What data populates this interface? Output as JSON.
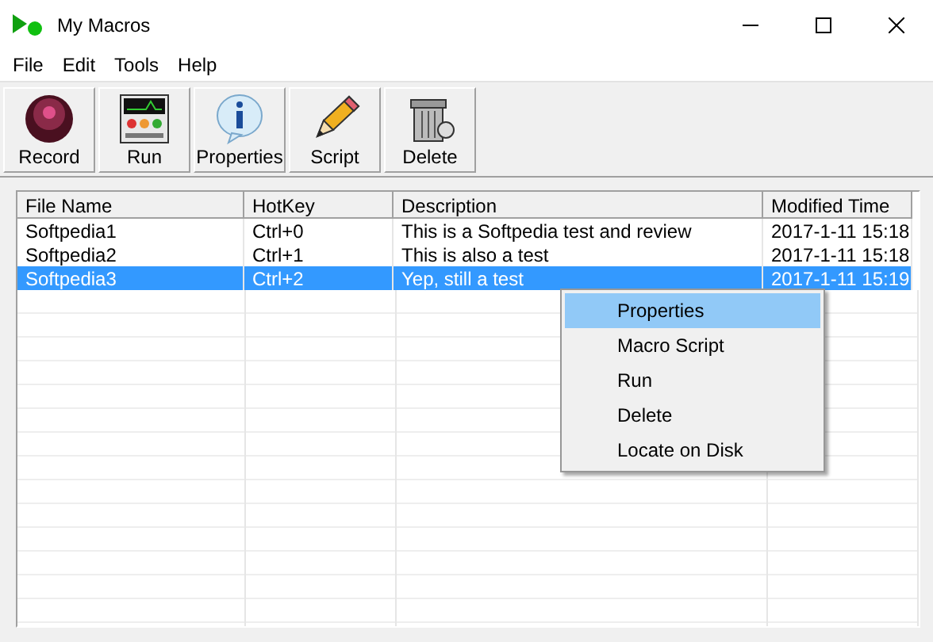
{
  "window": {
    "title": "My Macros"
  },
  "menu": [
    "File",
    "Edit",
    "Tools",
    "Help"
  ],
  "toolbar": [
    {
      "label": "Record",
      "kind": "record"
    },
    {
      "label": "Run",
      "kind": "run"
    },
    {
      "label": "Properties",
      "kind": "info"
    },
    {
      "label": "Script",
      "kind": "pencil"
    },
    {
      "label": "Delete",
      "kind": "trash"
    }
  ],
  "table": {
    "columns": [
      "File Name",
      "HotKey",
      "Description",
      "Modified Time"
    ],
    "rows": [
      {
        "cells": [
          "Softpedia1",
          "Ctrl+0",
          "This is a Softpedia test and review",
          "2017-1-11 15:18"
        ],
        "selected": false
      },
      {
        "cells": [
          "Softpedia2",
          "Ctrl+1",
          "This is also a test",
          "2017-1-11 15:18"
        ],
        "selected": false
      },
      {
        "cells": [
          "Softpedia3",
          "Ctrl+2",
          "Yep, still a test",
          "2017-1-11 15:19"
        ],
        "selected": true
      }
    ]
  },
  "context_menu": [
    {
      "label": "Properties",
      "selected": true
    },
    {
      "label": "Macro Script",
      "selected": false
    },
    {
      "label": "Run",
      "selected": false
    },
    {
      "label": "Delete",
      "selected": false
    },
    {
      "label": "Locate on Disk",
      "selected": false
    }
  ]
}
